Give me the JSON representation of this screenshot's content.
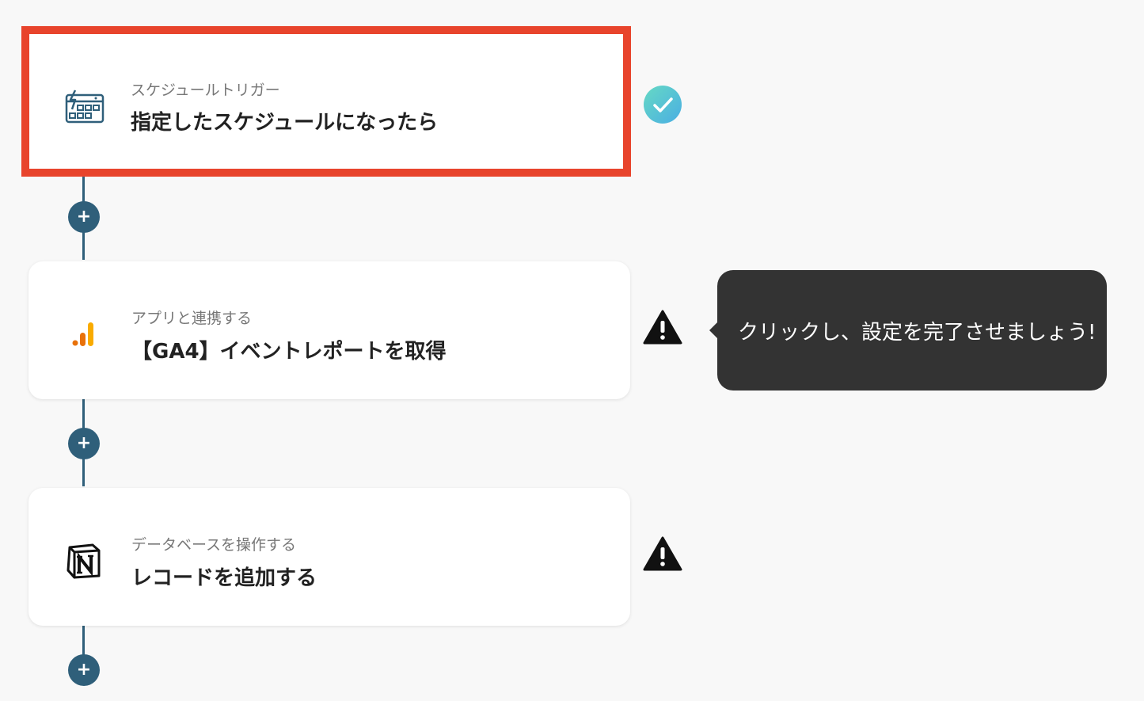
{
  "steps": [
    {
      "subtitle": "スケジュールトリガー",
      "title": "指定したスケジュールになったら",
      "icon": "schedule-calendar-icon",
      "status": "complete"
    },
    {
      "subtitle": "アプリと連携する",
      "title": "【GA4】イベントレポートを取得",
      "icon": "google-analytics-icon",
      "status": "warning"
    },
    {
      "subtitle": "データベースを操作する",
      "title": "レコードを追加する",
      "icon": "notion-icon",
      "status": "warning"
    }
  ],
  "add_button_label": "+",
  "tooltip": {
    "text": "クリックし、設定を完了させましょう!"
  },
  "colors": {
    "highlight": "#e8442c",
    "connector": "#2f5f7a",
    "check_gradient_start": "#5fd1c9",
    "check_gradient_end": "#4fb3e0",
    "tooltip_bg": "#333333"
  }
}
